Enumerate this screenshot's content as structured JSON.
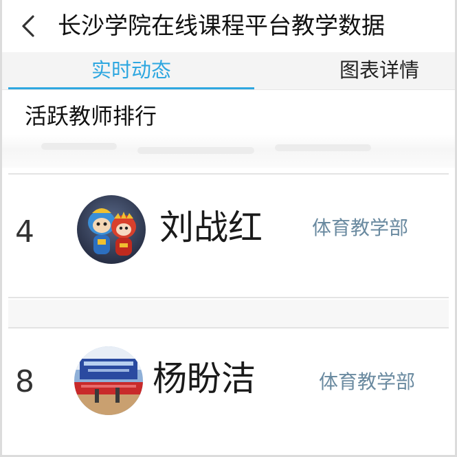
{
  "header": {
    "title": "长沙学院在线课程平台教学数据"
  },
  "tabs": [
    {
      "label": "实时动态",
      "active": true
    },
    {
      "label": "图表详情",
      "active": false
    }
  ],
  "section": {
    "title": "活跃教师排行"
  },
  "teachers": [
    {
      "rank": "4",
      "name": "刘战红",
      "department": "体育教学部"
    },
    {
      "rank": "8",
      "name": "杨盼洁",
      "department": "体育教学部"
    }
  ],
  "colors": {
    "accent": "#2ea7e0",
    "department_text": "#6a8aa0"
  }
}
